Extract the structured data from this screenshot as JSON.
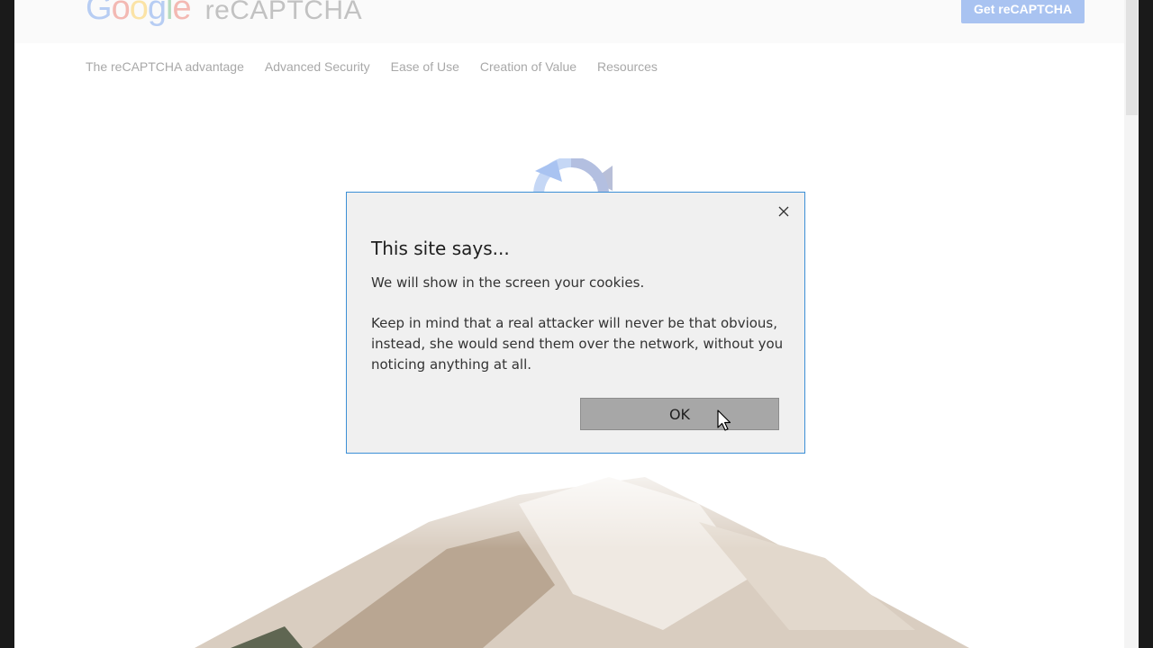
{
  "header": {
    "logo_google_letters": [
      "G",
      "o",
      "o",
      "g",
      "l",
      "e"
    ],
    "logo_product": "reCAPTCHA",
    "cta_label": "Get reCAPTCHA"
  },
  "subnav": {
    "items": [
      {
        "label": "The reCAPTCHA advantage"
      },
      {
        "label": "Advanced Security"
      },
      {
        "label": "Ease of Use"
      },
      {
        "label": "Creation of Value"
      },
      {
        "label": "Resources"
      }
    ]
  },
  "dialog": {
    "title": "This site says...",
    "message_line1": "We will show in the screen your cookies.",
    "message_line2": "Keep in mind that a real attacker will never be that obvious, instead, she would send them over the network, without you noticing anything at all.",
    "ok_label": "OK",
    "close_icon": "close-icon"
  },
  "colors": {
    "dialog_border": "#3c8fd6",
    "ok_button_bg": "#a7a7a7",
    "cta_bg": "#a9c3f1"
  }
}
